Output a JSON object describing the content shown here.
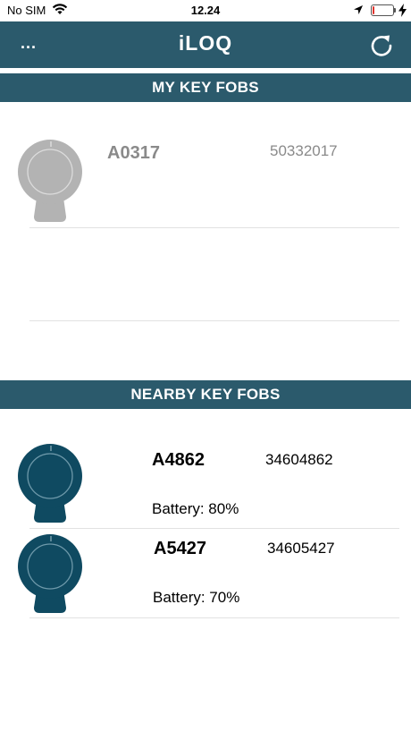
{
  "status_bar": {
    "carrier": "No SIM",
    "time": "12.24",
    "wifi_icon": "wifi-icon",
    "location_icon": "location-arrow-icon",
    "battery_icon": "battery-low-icon",
    "charging_icon": "charging-bolt-icon",
    "battery_level": 0.1
  },
  "app_bar": {
    "menu_label": "...",
    "logo": "iLOQ",
    "refresh_icon": "refresh-icon",
    "background": "#2b5a6c"
  },
  "my_key_fobs": {
    "header": "MY KEY FOBS",
    "items": [
      {
        "name": "A0317",
        "serial": "50332017",
        "icon": "key-fob-icon",
        "color": "#b3b3b3"
      }
    ]
  },
  "nearby_key_fobs": {
    "header": "NEARBY KEY FOBS",
    "items": [
      {
        "name": "A4862",
        "serial": "34604862",
        "battery": "Battery: 80%",
        "icon": "key-fob-icon",
        "color": "#0f4a61"
      },
      {
        "name": "A5427",
        "serial": "34605427",
        "battery": "Battery: 70%",
        "icon": "key-fob-icon",
        "color": "#0f4a61"
      }
    ]
  }
}
